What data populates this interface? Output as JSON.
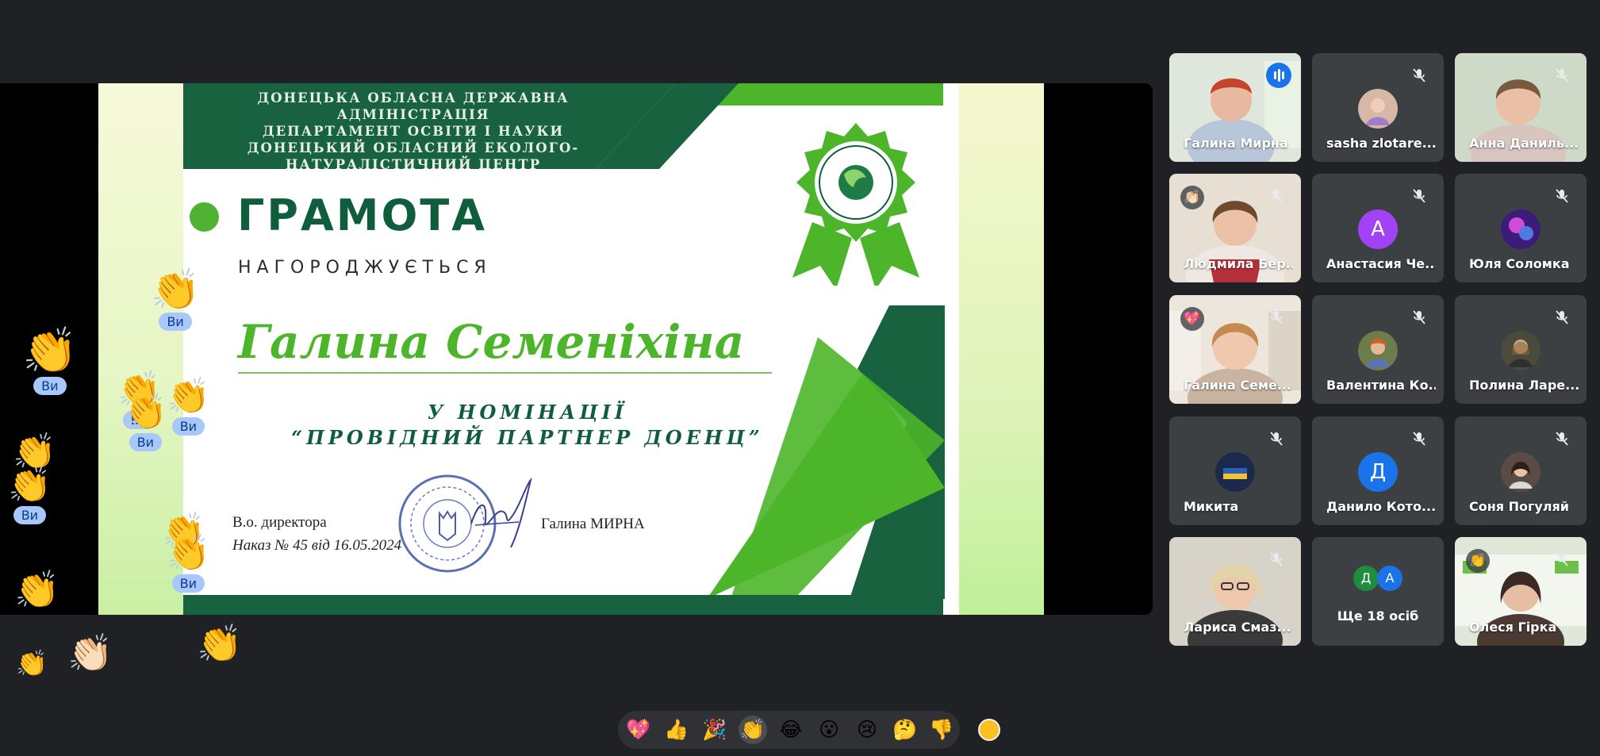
{
  "certificate": {
    "header_lines": [
      "ДОНЕЦЬКА ОБЛАСНА ДЕРЖАВНА АДМІНІСТРАЦІЯ",
      "ДЕПАРТАМЕНТ ОСВІТИ І НАУКИ",
      "ДОНЕЦЬКИЙ ОБЛАСНИЙ ЕКОЛОГО-",
      "НАТУРАЛІСТИЧНИЙ ЦЕНТР"
    ],
    "title": "ГРАМОТА",
    "awarded": "НАГОРОДЖУЄТЬСЯ",
    "recipient": "Галина Семеніхіна",
    "nomination_line1": "У НОМІНАЦІЇ",
    "nomination_line2": "“ПРОВІДНИЙ ПАРТНЕР ДОЕНЦ”",
    "director_label": "В.о. директора",
    "order_line": "Наказ № 45 від 16.05.2024",
    "signer": "Галина МИРНА",
    "colors": {
      "dark_green": "#0f5d3c",
      "light_green": "#4cb52a"
    }
  },
  "floating_reactions": {
    "you_label": "Ви",
    "items": [
      {
        "emoji": "👏",
        "label": "Ви"
      },
      {
        "emoji": "👏",
        "label": "Ви"
      },
      {
        "emoji": "👏",
        "label": "Ви"
      },
      {
        "emoji": "👏",
        "label": "Ви"
      },
      {
        "emoji": "👏",
        "label": "Ви"
      },
      {
        "emoji": "👏",
        "label": "Ви"
      },
      {
        "emoji": "👏",
        "label": "Ви"
      },
      {
        "emoji": "👏",
        "label": "Ви"
      },
      {
        "emoji": "👏",
        "label": ""
      },
      {
        "emoji": "👏",
        "label": ""
      },
      {
        "emoji": "👏🏻",
        "label": ""
      },
      {
        "emoji": "👏",
        "label": ""
      },
      {
        "emoji": "👏",
        "label": ""
      }
    ]
  },
  "participants": [
    {
      "name": "Галина Мирна",
      "speaking": true
    },
    {
      "name": "sasha zlotare..."
    },
    {
      "name": "Анна Даниль..."
    },
    {
      "name": "Людмила Бер..."
    },
    {
      "name": "Анастасия Че...",
      "initial": "А",
      "color": "#a142f4"
    },
    {
      "name": "Юля Соломка"
    },
    {
      "name": "Галина Семе..."
    },
    {
      "name": "Валентина Ко..."
    },
    {
      "name": "Полина Ларе..."
    },
    {
      "name": "Микита"
    },
    {
      "name": "Данило Котo...",
      "initial": "Д",
      "color": "#1a73e8"
    },
    {
      "name": "Соня Погуляй"
    },
    {
      "name": "Лариса Смаз..."
    },
    {
      "name": "Ще 18 осіб",
      "mini": [
        {
          "initial": "Д",
          "color": "#1e8e3e"
        },
        {
          "initial": "А",
          "color": "#1a73e8"
        }
      ]
    },
    {
      "name": "Олеся Гірка"
    }
  ],
  "reaction_bar": {
    "emojis": [
      "💖",
      "👍",
      "🎉",
      "👏",
      "😂",
      "😮",
      "😢",
      "🤔",
      "👎"
    ],
    "selected": "👏",
    "skin_tone_color": "#fbbf24"
  }
}
